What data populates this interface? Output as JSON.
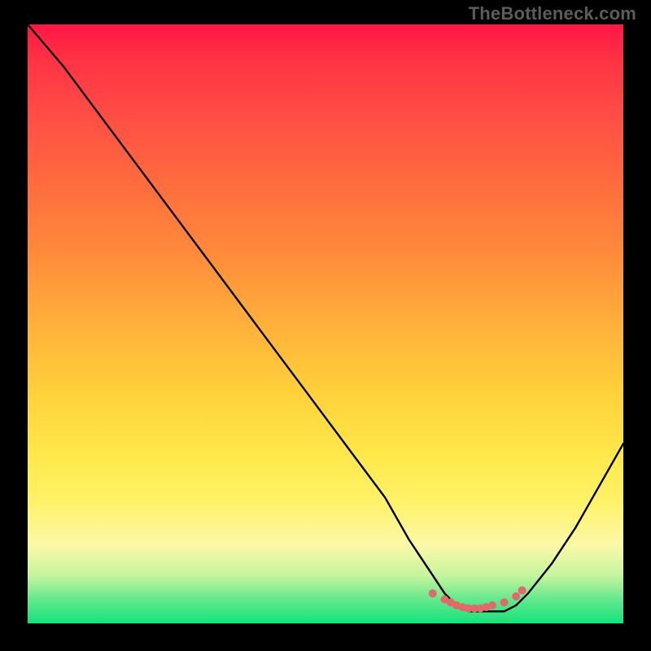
{
  "watermark": "TheBottleneck.com",
  "chart_data": {
    "type": "line",
    "title": "",
    "xlabel": "",
    "ylabel": "",
    "xlim": [
      0,
      100
    ],
    "ylim": [
      0,
      100
    ],
    "series": [
      {
        "name": "bottleneck-curve",
        "x": [
          0,
          6,
          12,
          18,
          24,
          30,
          36,
          42,
          48,
          54,
          60,
          64,
          68,
          70,
          72,
          74,
          76,
          78,
          80,
          82,
          84,
          88,
          92,
          96,
          100
        ],
        "values": [
          100,
          93,
          85,
          77,
          69,
          61,
          53,
          45,
          37,
          29,
          21,
          14,
          8,
          5,
          3,
          2,
          2,
          2,
          2,
          3,
          5,
          10,
          16,
          23,
          30
        ]
      }
    ],
    "annotations": [
      {
        "name": "optimal-zone-markers",
        "x": [
          68,
          70,
          71,
          72,
          73,
          74,
          75,
          76,
          77,
          78,
          80,
          82,
          83
        ],
        "values": [
          5,
          4,
          3.5,
          3,
          2.7,
          2.5,
          2.5,
          2.5,
          2.7,
          3,
          3.5,
          4.5,
          5.5
        ]
      }
    ],
    "gradient_stops": [
      {
        "pos": 0,
        "color": "#ff1744"
      },
      {
        "pos": 50,
        "color": "#ffb03a"
      },
      {
        "pos": 80,
        "color": "#fff26a"
      },
      {
        "pos": 100,
        "color": "#16e27a"
      }
    ]
  }
}
